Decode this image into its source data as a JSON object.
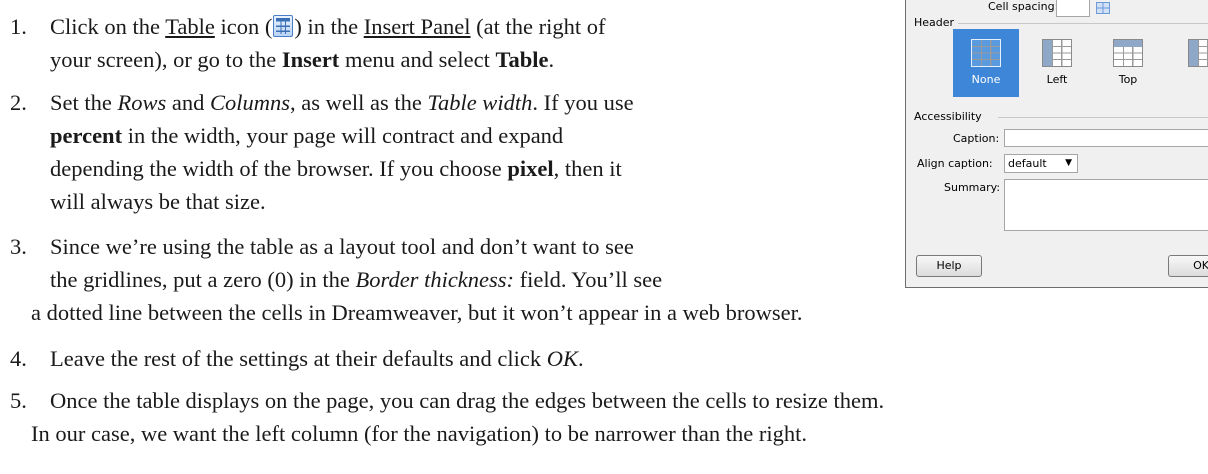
{
  "steps": [
    {
      "number": "1.",
      "line1_pre": "Click on the ",
      "line1_link1": "Table",
      "line1_mid": " icon (",
      "line1_post": ") in the ",
      "line1_link2": "Insert Panel",
      "line1_end": " (at the right of",
      "line2_pre": "your screen), or go to the ",
      "line2_bold1": "Insert",
      "line2_mid": " menu and select ",
      "line2_bold2": "Table",
      "line2_end": "."
    },
    {
      "number": "2.",
      "line1_pre": "Set the ",
      "line1_it1": "Rows",
      "line1_mid": " and ",
      "line1_it2": "Columns",
      "line1_mid2": ", as well as the ",
      "line1_it3": "Table width",
      "line1_end": ". If you use",
      "line2_bold": "percent",
      "line2_end": " in the width, your page will contract and expand",
      "line3": "depending the width of the browser. If you choose ",
      "line3_bold": "pixel",
      "line3_end": ", then it",
      "line4": "will always be that size."
    },
    {
      "number": "3.",
      "line1": "Since we’re using the table as a layout tool and don’t want to see",
      "line2_pre": "the gridlines, put a zero (0) in the ",
      "line2_it": "Border thickness:",
      "line2_end": "  field. You’ll see",
      "line3": "a dotted line between the cells in Dreamweaver, but it won’t appear in a web browser."
    },
    {
      "number": "4.",
      "line1_pre": "Leave the rest of the settings at their defaults and click ",
      "line1_it": "OK",
      "line1_end": "."
    },
    {
      "number": "5.",
      "line1": "Once the table displays on the page, you can drag the edges between the cells to resize them.",
      "line2": "In our case, we want the left column (for the navigation) to be narrower than the right."
    }
  ],
  "icons": {
    "table_icon": "table-grid-icon"
  },
  "dialog": {
    "cell_spacing_label": "Cell spacing:",
    "header_legend": "Header",
    "header_options": [
      "None",
      "Left",
      "Top"
    ],
    "selected_header": "None",
    "accessibility_legend": "Accessibility",
    "caption_label": "Caption:",
    "align_caption_label": "Align caption:",
    "align_caption_value": "default",
    "summary_label": "Summary:",
    "help_button": "Help",
    "ok_button": "OK"
  },
  "colors": {
    "selected_option": "#3d86d8",
    "dialog_bg": "#f0f0f0"
  }
}
